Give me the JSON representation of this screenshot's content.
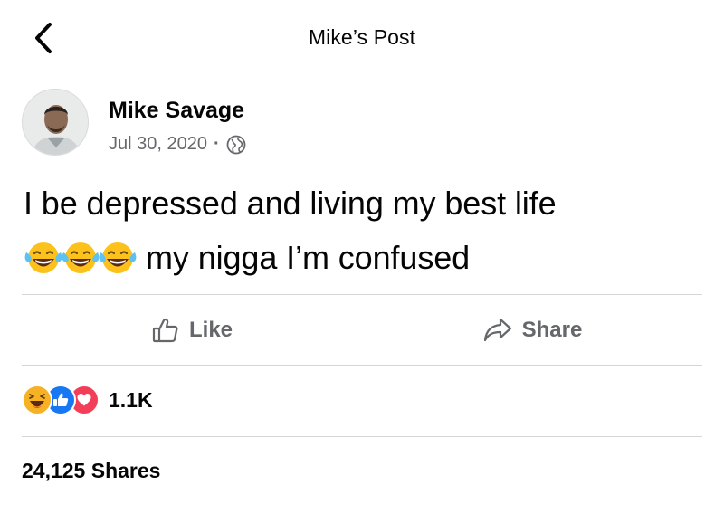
{
  "top_bar": {
    "title": "Mike’s Post",
    "back_icon": "chevron-left-icon"
  },
  "post": {
    "author": "Mike Savage",
    "date": "Jul 30, 2020",
    "separator": "·",
    "privacy_icon": "globe-icon",
    "text_line1": "I be depressed and living my best life",
    "emojis": [
      "tears-of-joy-emoji",
      "tears-of-joy-emoji",
      "tears-of-joy-emoji"
    ],
    "text_line2": "my nigga I’m confused"
  },
  "actions": {
    "like_label": "Like",
    "share_label": "Share"
  },
  "reactions": {
    "icons": [
      "haha-reaction-icon",
      "like-reaction-icon",
      "love-reaction-icon"
    ],
    "count": "1.1K"
  },
  "shares": {
    "label": "24,125 Shares"
  },
  "colors": {
    "text": "#050505",
    "secondary_text": "#65676b",
    "divider": "#d3d5d9",
    "like_blue": "#1877f2",
    "love_red": "#f33e58",
    "haha_yellow": "#f7b125"
  }
}
